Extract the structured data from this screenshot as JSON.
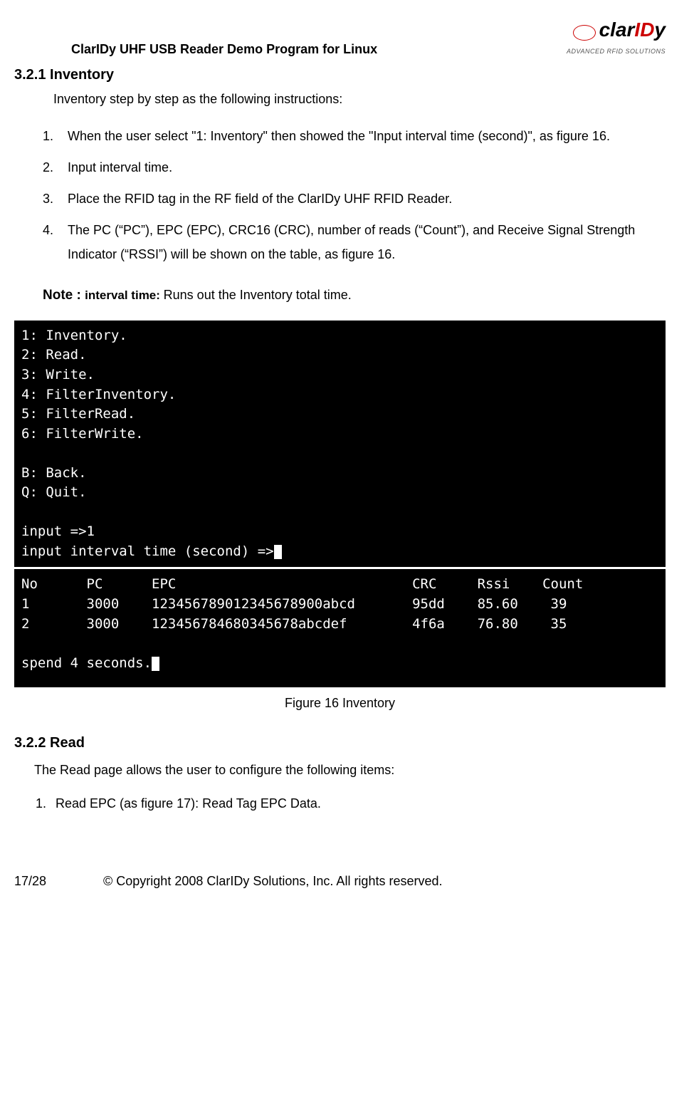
{
  "header": {
    "doc_title": "ClarIDy  UHF  USB  Reader  Demo  Program  for  Linux",
    "logo_text_clar": "clar",
    "logo_text_id": "ID",
    "logo_text_y": "y",
    "logo_tagline": "ADVANCED RFID SOLUTIONS"
  },
  "section1": {
    "heading": "3.2.1 Inventory",
    "intro": "Inventory step by step as the following instructions:",
    "steps": [
      "When the user select \"1: Inventory\" then showed the \"Input interval time (second)\", as figure 16.",
      "Input interval time.",
      "Place the RFID tag in the RF field of the ClarIDy UHF RFID Reader.",
      "The PC (“PC”), EPC (EPC), CRC16 (CRC), number of reads (“Count”), and Receive Signal Strength Indicator (“RSSI”) will be shown on the table, as figure 16."
    ],
    "note_label": "Note : ",
    "note_strong": "interval time: ",
    "note_text": "Runs out the Inventory total time."
  },
  "terminal": {
    "menu": "1: Inventory.\n2: Read.\n3: Write.\n4: FilterInventory.\n5: FilterRead.\n6: FilterWrite.\n\nB: Back.\nQ: Quit.\n\ninput =>1\ninput interval time (second) =>",
    "table_header": "No      PC      EPC                             CRC     Rssi    Count",
    "rows": [
      "1       3000    123456789012345678900abcd       95dd    85.60    39",
      "2       3000    123456784680345678abcdef        4f6a    76.80    35"
    ],
    "spend": "spend 4 seconds."
  },
  "caption": {
    "prefix": "Figure 16 ",
    "name": "Inventory"
  },
  "section2": {
    "heading": "3.2.2 Read",
    "intro": "The Read page allows the user to configure the following items:",
    "steps": [
      "Read EPC (as figure 17): Read Tag EPC Data."
    ]
  },
  "footer": {
    "page": "17/28",
    "copyright": "© Copyright 2008 ClarIDy Solutions, Inc. All rights reserved."
  }
}
